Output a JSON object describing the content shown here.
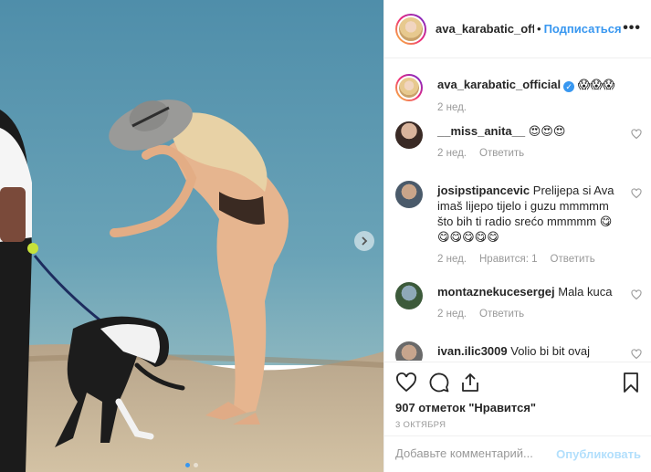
{
  "post": {
    "author": "ava_karabatic_official",
    "author_header": "ava_karabatic_offici",
    "separator": "•",
    "follow_label": "Подписаться",
    "more_label": "•••",
    "caption_emoji": "😱😱😱",
    "caption_time": "2 нед.",
    "likes": "907 отметок \"Нравится\"",
    "date": "3 ОКТЯБРЯ",
    "add_comment_placeholder": "Добавьте комментарий...",
    "publish_label": "Опубликовать"
  },
  "comments": [
    {
      "user": "__miss_anita__",
      "text": "😍😍😍",
      "time": "2 нед.",
      "reply": "Ответить",
      "likes": ""
    },
    {
      "user": "josipstipancevic",
      "text": "Prelijepa si Ava imaš lijepo tijelo i guzu mmmmm što bih ti radio srećo mmmmm 😋😋😋😋😋😋",
      "time": "2 нед.",
      "likes": "Нравится: 1",
      "reply": "Ответить"
    },
    {
      "user": "montaznekucesergej",
      "text": "Mala kuca",
      "time": "2 нед.",
      "reply": "Ответить",
      "likes": ""
    },
    {
      "user": "ivan.ilic3009",
      "text": "Volio bi bit ovaj",
      "time": "",
      "reply": "",
      "likes": ""
    }
  ],
  "icons": {
    "like": "heart-icon",
    "comment": "comment-icon",
    "share": "share-icon",
    "save": "bookmark-icon",
    "next": "chevron-right-icon"
  },
  "colors": {
    "link": "#3897f0",
    "muted": "#999999",
    "text": "#262626"
  }
}
